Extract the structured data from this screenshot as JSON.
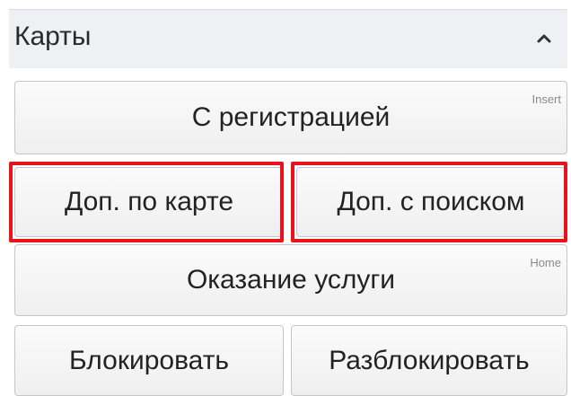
{
  "panel": {
    "title": "Карты",
    "collapse_icon": "chevron-up-icon"
  },
  "buttons": {
    "registration": {
      "label": "С регистрацией",
      "hotkey": "Insert"
    },
    "extra_by_card": {
      "label": "Доп. по карте"
    },
    "extra_with_search": {
      "label": "Доп. с поиском"
    },
    "service": {
      "label": "Оказание услуги",
      "hotkey": "Home"
    },
    "block": {
      "label": "Блокировать"
    },
    "unblock": {
      "label": "Разблокировать"
    }
  },
  "colors": {
    "highlight": "#e8141b",
    "header_bg": "#eef0f3"
  }
}
